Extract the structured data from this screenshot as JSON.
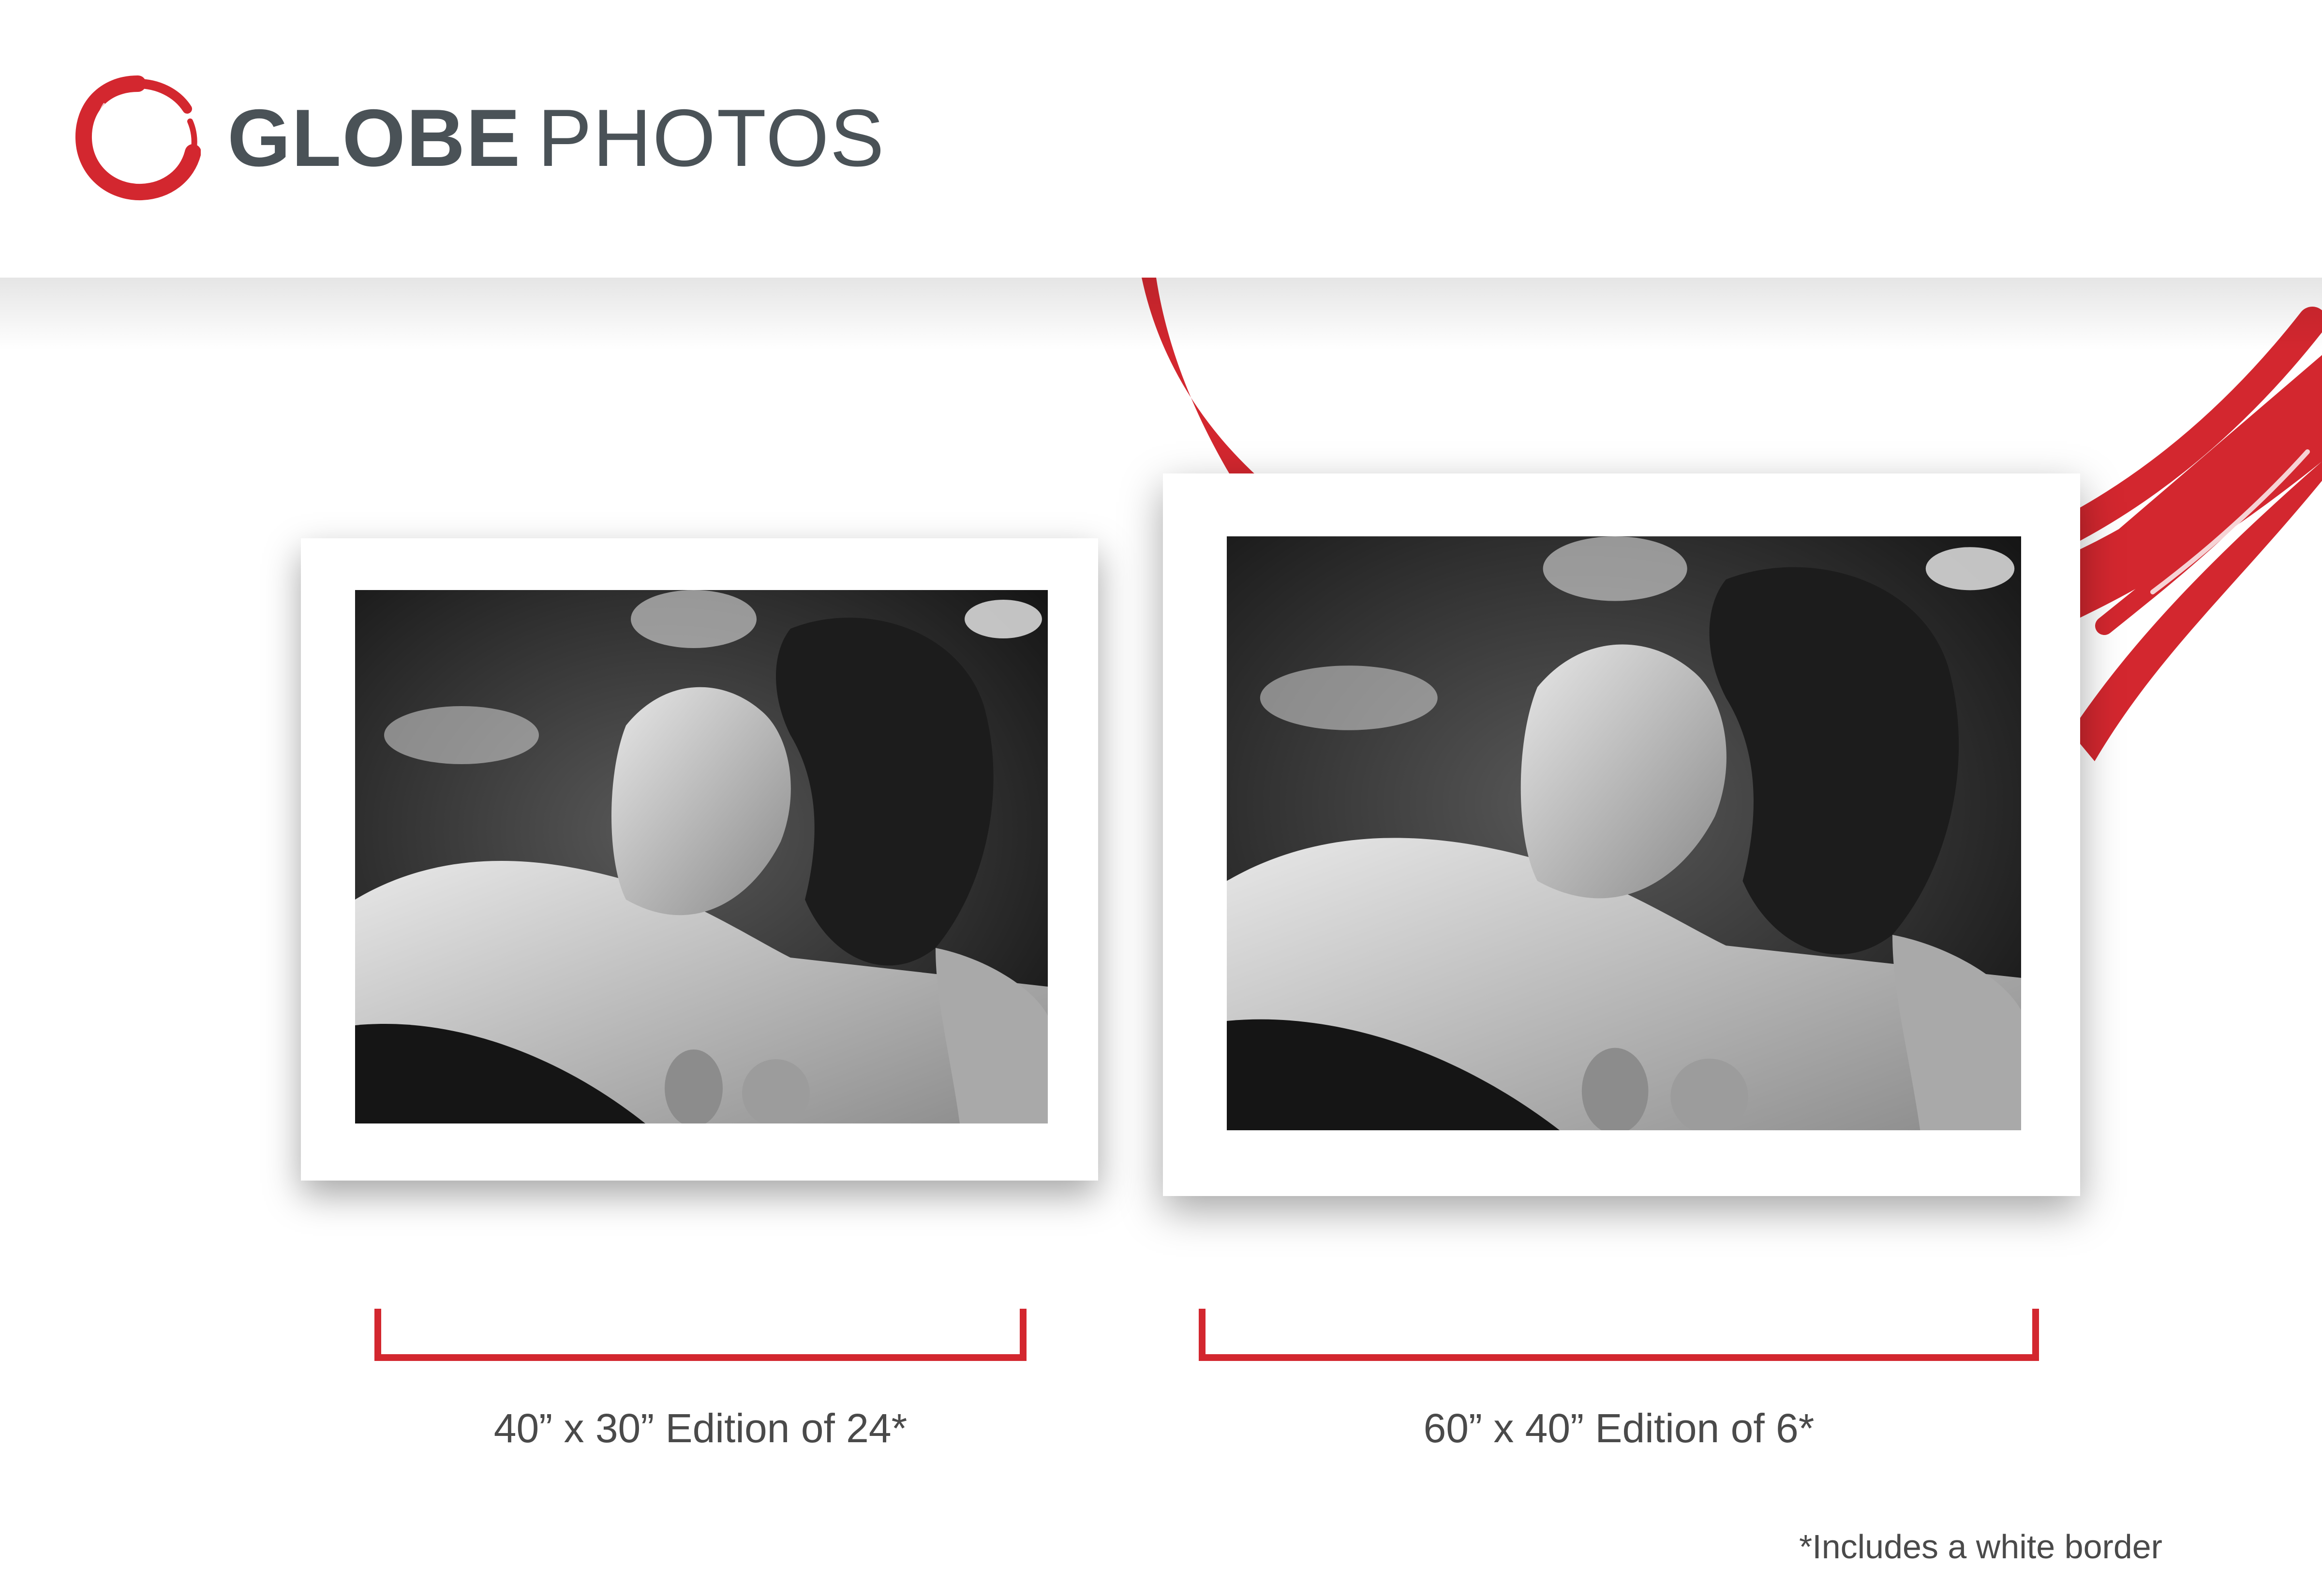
{
  "brand": {
    "name_bold": "GLOBE",
    "name_light": "PHOTOS",
    "accent_color": "#d3272f",
    "text_color": "#4a5257",
    "logo_icon": "brush-circle-icon"
  },
  "prints": [
    {
      "caption": "40” x 30” Edition of 24*",
      "photo": "black-and-white-portrait"
    },
    {
      "caption": "60” x 40” Edition of 6*",
      "photo": "black-and-white-portrait"
    }
  ],
  "footnote": "*Includes a white border"
}
